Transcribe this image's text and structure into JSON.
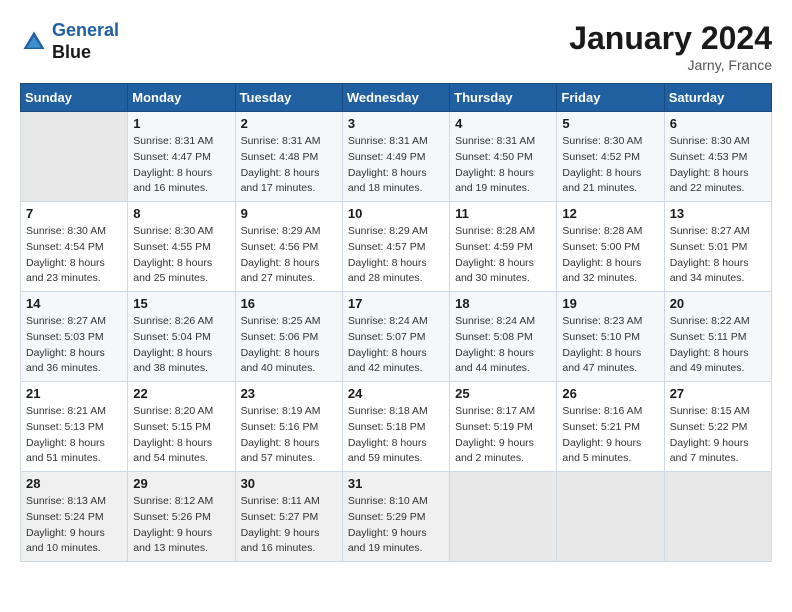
{
  "header": {
    "logo_line1": "General",
    "logo_line2": "Blue",
    "title": "January 2024",
    "location": "Jarny, France"
  },
  "columns": [
    "Sunday",
    "Monday",
    "Tuesday",
    "Wednesday",
    "Thursday",
    "Friday",
    "Saturday"
  ],
  "weeks": [
    [
      {
        "day": "",
        "sunrise": "",
        "sunset": "",
        "daylight": ""
      },
      {
        "day": "1",
        "sunrise": "Sunrise: 8:31 AM",
        "sunset": "Sunset: 4:47 PM",
        "daylight": "Daylight: 8 hours and 16 minutes."
      },
      {
        "day": "2",
        "sunrise": "Sunrise: 8:31 AM",
        "sunset": "Sunset: 4:48 PM",
        "daylight": "Daylight: 8 hours and 17 minutes."
      },
      {
        "day": "3",
        "sunrise": "Sunrise: 8:31 AM",
        "sunset": "Sunset: 4:49 PM",
        "daylight": "Daylight: 8 hours and 18 minutes."
      },
      {
        "day": "4",
        "sunrise": "Sunrise: 8:31 AM",
        "sunset": "Sunset: 4:50 PM",
        "daylight": "Daylight: 8 hours and 19 minutes."
      },
      {
        "day": "5",
        "sunrise": "Sunrise: 8:30 AM",
        "sunset": "Sunset: 4:52 PM",
        "daylight": "Daylight: 8 hours and 21 minutes."
      },
      {
        "day": "6",
        "sunrise": "Sunrise: 8:30 AM",
        "sunset": "Sunset: 4:53 PM",
        "daylight": "Daylight: 8 hours and 22 minutes."
      }
    ],
    [
      {
        "day": "7",
        "sunrise": "Sunrise: 8:30 AM",
        "sunset": "Sunset: 4:54 PM",
        "daylight": "Daylight: 8 hours and 23 minutes."
      },
      {
        "day": "8",
        "sunrise": "Sunrise: 8:30 AM",
        "sunset": "Sunset: 4:55 PM",
        "daylight": "Daylight: 8 hours and 25 minutes."
      },
      {
        "day": "9",
        "sunrise": "Sunrise: 8:29 AM",
        "sunset": "Sunset: 4:56 PM",
        "daylight": "Daylight: 8 hours and 27 minutes."
      },
      {
        "day": "10",
        "sunrise": "Sunrise: 8:29 AM",
        "sunset": "Sunset: 4:57 PM",
        "daylight": "Daylight: 8 hours and 28 minutes."
      },
      {
        "day": "11",
        "sunrise": "Sunrise: 8:28 AM",
        "sunset": "Sunset: 4:59 PM",
        "daylight": "Daylight: 8 hours and 30 minutes."
      },
      {
        "day": "12",
        "sunrise": "Sunrise: 8:28 AM",
        "sunset": "Sunset: 5:00 PM",
        "daylight": "Daylight: 8 hours and 32 minutes."
      },
      {
        "day": "13",
        "sunrise": "Sunrise: 8:27 AM",
        "sunset": "Sunset: 5:01 PM",
        "daylight": "Daylight: 8 hours and 34 minutes."
      }
    ],
    [
      {
        "day": "14",
        "sunrise": "Sunrise: 8:27 AM",
        "sunset": "Sunset: 5:03 PM",
        "daylight": "Daylight: 8 hours and 36 minutes."
      },
      {
        "day": "15",
        "sunrise": "Sunrise: 8:26 AM",
        "sunset": "Sunset: 5:04 PM",
        "daylight": "Daylight: 8 hours and 38 minutes."
      },
      {
        "day": "16",
        "sunrise": "Sunrise: 8:25 AM",
        "sunset": "Sunset: 5:06 PM",
        "daylight": "Daylight: 8 hours and 40 minutes."
      },
      {
        "day": "17",
        "sunrise": "Sunrise: 8:24 AM",
        "sunset": "Sunset: 5:07 PM",
        "daylight": "Daylight: 8 hours and 42 minutes."
      },
      {
        "day": "18",
        "sunrise": "Sunrise: 8:24 AM",
        "sunset": "Sunset: 5:08 PM",
        "daylight": "Daylight: 8 hours and 44 minutes."
      },
      {
        "day": "19",
        "sunrise": "Sunrise: 8:23 AM",
        "sunset": "Sunset: 5:10 PM",
        "daylight": "Daylight: 8 hours and 47 minutes."
      },
      {
        "day": "20",
        "sunrise": "Sunrise: 8:22 AM",
        "sunset": "Sunset: 5:11 PM",
        "daylight": "Daylight: 8 hours and 49 minutes."
      }
    ],
    [
      {
        "day": "21",
        "sunrise": "Sunrise: 8:21 AM",
        "sunset": "Sunset: 5:13 PM",
        "daylight": "Daylight: 8 hours and 51 minutes."
      },
      {
        "day": "22",
        "sunrise": "Sunrise: 8:20 AM",
        "sunset": "Sunset: 5:15 PM",
        "daylight": "Daylight: 8 hours and 54 minutes."
      },
      {
        "day": "23",
        "sunrise": "Sunrise: 8:19 AM",
        "sunset": "Sunset: 5:16 PM",
        "daylight": "Daylight: 8 hours and 57 minutes."
      },
      {
        "day": "24",
        "sunrise": "Sunrise: 8:18 AM",
        "sunset": "Sunset: 5:18 PM",
        "daylight": "Daylight: 8 hours and 59 minutes."
      },
      {
        "day": "25",
        "sunrise": "Sunrise: 8:17 AM",
        "sunset": "Sunset: 5:19 PM",
        "daylight": "Daylight: 9 hours and 2 minutes."
      },
      {
        "day": "26",
        "sunrise": "Sunrise: 8:16 AM",
        "sunset": "Sunset: 5:21 PM",
        "daylight": "Daylight: 9 hours and 5 minutes."
      },
      {
        "day": "27",
        "sunrise": "Sunrise: 8:15 AM",
        "sunset": "Sunset: 5:22 PM",
        "daylight": "Daylight: 9 hours and 7 minutes."
      }
    ],
    [
      {
        "day": "28",
        "sunrise": "Sunrise: 8:13 AM",
        "sunset": "Sunset: 5:24 PM",
        "daylight": "Daylight: 9 hours and 10 minutes."
      },
      {
        "day": "29",
        "sunrise": "Sunrise: 8:12 AM",
        "sunset": "Sunset: 5:26 PM",
        "daylight": "Daylight: 9 hours and 13 minutes."
      },
      {
        "day": "30",
        "sunrise": "Sunrise: 8:11 AM",
        "sunset": "Sunset: 5:27 PM",
        "daylight": "Daylight: 9 hours and 16 minutes."
      },
      {
        "day": "31",
        "sunrise": "Sunrise: 8:10 AM",
        "sunset": "Sunset: 5:29 PM",
        "daylight": "Daylight: 9 hours and 19 minutes."
      },
      {
        "day": "",
        "sunrise": "",
        "sunset": "",
        "daylight": ""
      },
      {
        "day": "",
        "sunrise": "",
        "sunset": "",
        "daylight": ""
      },
      {
        "day": "",
        "sunrise": "",
        "sunset": "",
        "daylight": ""
      }
    ]
  ]
}
